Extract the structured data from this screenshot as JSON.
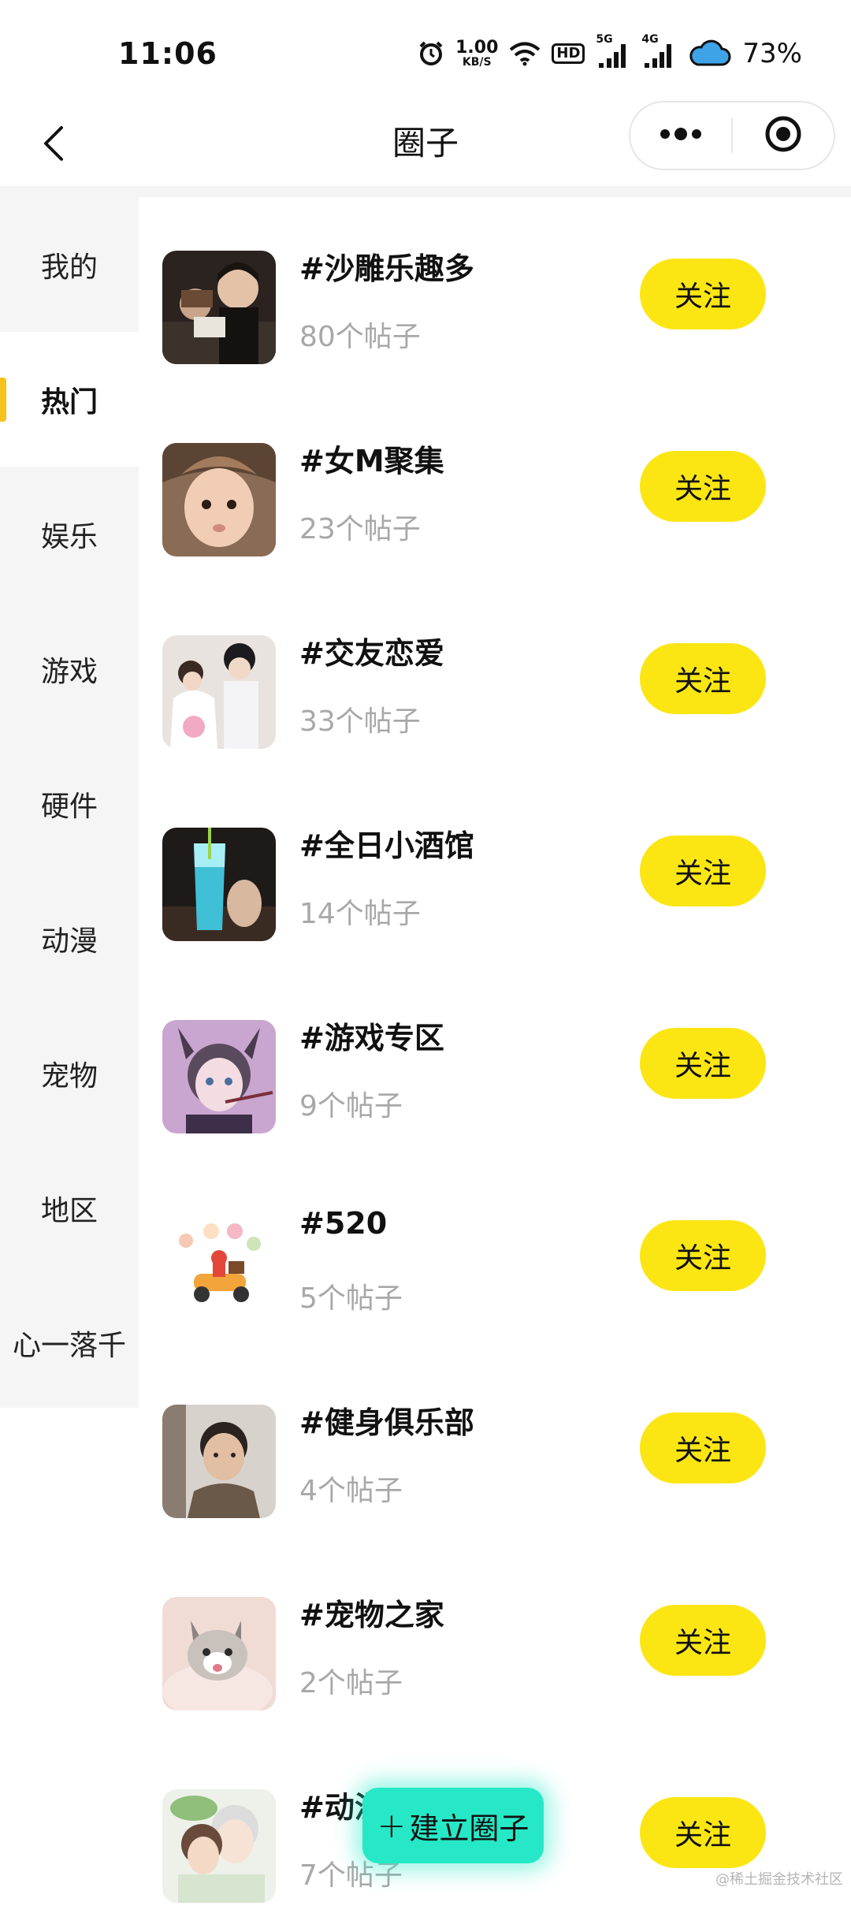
{
  "status_bar": {
    "time": "11:06",
    "net_speed_value": "1.00",
    "net_speed_unit": "KB/S",
    "hd_label": "HD",
    "signal1_tag": "5G",
    "signal2_tag": "4G",
    "battery": "73%",
    "icons": [
      "alarm-icon",
      "wifi-icon",
      "hd-icon",
      "signal-5g-icon",
      "signal-4g-icon",
      "cloud-icon"
    ]
  },
  "nav": {
    "title": "圈子",
    "back_icon": "chevron-left-icon",
    "more_icon": "more-dots-icon",
    "close_icon": "target-icon"
  },
  "sidebar": {
    "active_index": 1,
    "items": [
      {
        "label": "我的"
      },
      {
        "label": "热门"
      },
      {
        "label": "娱乐"
      },
      {
        "label": "游戏"
      },
      {
        "label": "硬件"
      },
      {
        "label": "动漫"
      },
      {
        "label": "宠物"
      },
      {
        "label": "地区"
      },
      {
        "label": "心一落千"
      }
    ],
    "accent_color": "#f6c21b"
  },
  "circles": [
    {
      "title": "#沙雕乐趣多",
      "count": "80个帖子",
      "follow_label": "关注",
      "thumb": "two-people-photo"
    },
    {
      "title": "#女M聚集",
      "count": "23个帖子",
      "follow_label": "关注",
      "thumb": "girl-selfie-photo"
    },
    {
      "title": "#交友恋爱",
      "count": "33个帖子",
      "follow_label": "关注",
      "thumb": "couple-photo"
    },
    {
      "title": "#全日小酒馆",
      "count": "14个帖子",
      "follow_label": "关注",
      "thumb": "cocktail-photo"
    },
    {
      "title": "#游戏专区",
      "count": "9个帖子",
      "follow_label": "关注",
      "thumb": "game-character-image"
    },
    {
      "title": "#520",
      "count": "5个帖子",
      "follow_label": "关注",
      "thumb": "delivery-scooter-illustration"
    },
    {
      "title": "#健身俱乐部",
      "count": "4个帖子",
      "follow_label": "关注",
      "thumb": "man-portrait-photo"
    },
    {
      "title": "#宠物之家",
      "count": "2个帖子",
      "follow_label": "关注",
      "thumb": "kitten-photo"
    },
    {
      "title": "#动漫",
      "count": "7个帖子",
      "follow_label": "关注",
      "thumb": "anime-girl-image"
    }
  ],
  "fab": {
    "plus": "+",
    "label": "建立圈子",
    "color": "#26e8c6"
  },
  "follow_color": "#fbe614",
  "watermark": "@稀土掘金技术社区"
}
